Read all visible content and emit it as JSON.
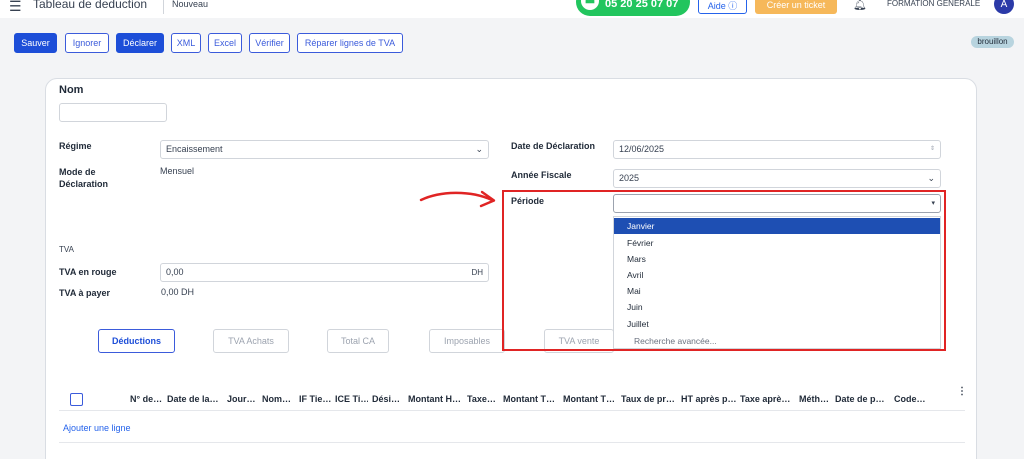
{
  "header": {
    "title": "Tableau de deduction",
    "breadcrumb": "Nouveau",
    "phone": "05 20 25 07 07",
    "help_label": "Aide ⓘ",
    "ticket_label": "Créer un ticket",
    "company": "FORMATION GENERALE",
    "avatar_initial": "A"
  },
  "toolbar": {
    "save": "Sauver",
    "ignore": "Ignorer",
    "declare": "Déclarer",
    "xml": "XML",
    "excel": "Excel",
    "verify": "Vérifier",
    "repair": "Réparer lignes de TVA",
    "status": "brouillon"
  },
  "form": {
    "nom_label": "Nom",
    "nom_value": "",
    "regime_label": "Régime",
    "regime_value": "Encaissement",
    "mode_label": "Mode de Déclaration",
    "mode_value": "Mensuel",
    "date_label": "Date de Déclaration",
    "date_value": "12/06/2025",
    "annee_label": "Année Fiscale",
    "annee_value": "2025",
    "periode_label": "Période",
    "periode_value": "",
    "tva_section": "TVA",
    "tva_rouge_label": "TVA en rouge",
    "tva_rouge_value": "0,00",
    "tva_rouge_suffix": "DH",
    "tva_payer_label": "TVA à payer",
    "tva_payer_value": "0,00 DH"
  },
  "periode_options": [
    "Janvier",
    "Février",
    "Mars",
    "Avril",
    "Mai",
    "Juin",
    "Juillet"
  ],
  "periode_selected": "Janvier",
  "periode_advanced": "Recherche avancée...",
  "tabs": [
    "Déductions",
    "TVA Achats",
    "Total CA",
    "Imposables",
    "TVA vente"
  ],
  "table": {
    "headers": [
      "N° de…",
      "Date de la…",
      "Jour…",
      "Nom…",
      "IF Tie…",
      "ICE Ti…",
      "Dési…",
      "Montant H…",
      "Taxe…",
      "Montant T…",
      "Montant T…",
      "Taux de pr…",
      "HT après p…",
      "Taxe aprè…",
      "Méth…",
      "Date de p…",
      "Code…"
    ],
    "add_line": "Ajouter une ligne"
  },
  "colors": {
    "primary": "#1d4ed8",
    "phone_green": "#22c55e",
    "ticket_orange": "#f6b85a",
    "highlight_red": "#e02424",
    "selected_option": "#1e4fb3"
  }
}
